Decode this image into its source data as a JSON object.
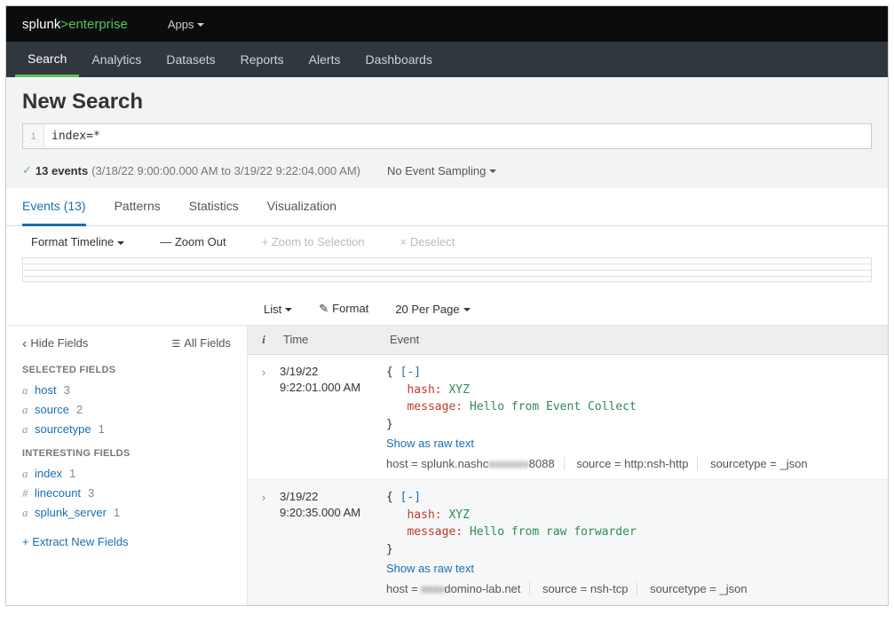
{
  "brand": {
    "part1": "splunk",
    "gt": ">",
    "part2": "enterprise"
  },
  "topbar": {
    "apps": "Apps"
  },
  "nav": [
    "Search",
    "Analytics",
    "Datasets",
    "Reports",
    "Alerts",
    "Dashboards"
  ],
  "nav_active": 0,
  "page_title": "New Search",
  "search": {
    "line_no": "1",
    "query": "index=*"
  },
  "status": {
    "check": "✓",
    "count": "13 events",
    "range": "(3/18/22 9:00:00.000 AM to 3/19/22 9:22:04.000 AM)",
    "sampling": "No Event Sampling"
  },
  "tabs": [
    {
      "label": "Events (13)",
      "active": true
    },
    {
      "label": "Patterns",
      "active": false
    },
    {
      "label": "Statistics",
      "active": false
    },
    {
      "label": "Visualization",
      "active": false
    }
  ],
  "timeline_toolbar": {
    "format": "Format Timeline",
    "zoom_out": "— Zoom Out",
    "zoom_sel": "+ Zoom to Selection",
    "deselect": "× Deselect"
  },
  "list_toolbar": {
    "list": "List",
    "format": "Format",
    "perpage": "20 Per Page"
  },
  "sidebar": {
    "hide": "Hide Fields",
    "all": "All Fields",
    "selected_header": "SELECTED FIELDS",
    "selected": [
      {
        "type": "a",
        "name": "host",
        "count": "3"
      },
      {
        "type": "a",
        "name": "source",
        "count": "2"
      },
      {
        "type": "a",
        "name": "sourcetype",
        "count": "1"
      }
    ],
    "interesting_header": "INTERESTING FIELDS",
    "interesting": [
      {
        "type": "a",
        "name": "index",
        "count": "1"
      },
      {
        "type": "#",
        "name": "linecount",
        "count": "3"
      },
      {
        "type": "a",
        "name": "splunk_server",
        "count": "1"
      }
    ],
    "extract": "+ Extract New Fields"
  },
  "table": {
    "hdr_i": "i",
    "hdr_time": "Time",
    "hdr_event": "Event"
  },
  "events": [
    {
      "time1": "3/19/22",
      "time2": "9:22:01.000 AM",
      "hash_key": "hash",
      "hash_val": "XYZ",
      "msg_key": "message",
      "msg_val": "Hello from Event Collect",
      "rawlink": "Show as raw text",
      "host_prefix": "host = splunk.nashc",
      "host_blur": "xxxxxxx",
      "host_suffix": "8088",
      "source": "source = http:nsh-http",
      "sourcetype": "sourcetype = _json"
    },
    {
      "time1": "3/19/22",
      "time2": "9:20:35.000 AM",
      "hash_key": "hash",
      "hash_val": "XYZ",
      "msg_key": "message",
      "msg_val": "Hello from raw forwarder",
      "rawlink": "Show as raw text",
      "host_prefix": "host = ",
      "host_blur": "xxxx",
      "host_suffix": "domino-lab.net",
      "source": "source = nsh-tcp",
      "sourcetype": "sourcetype = _json"
    }
  ],
  "collapse_marker": "[-]"
}
